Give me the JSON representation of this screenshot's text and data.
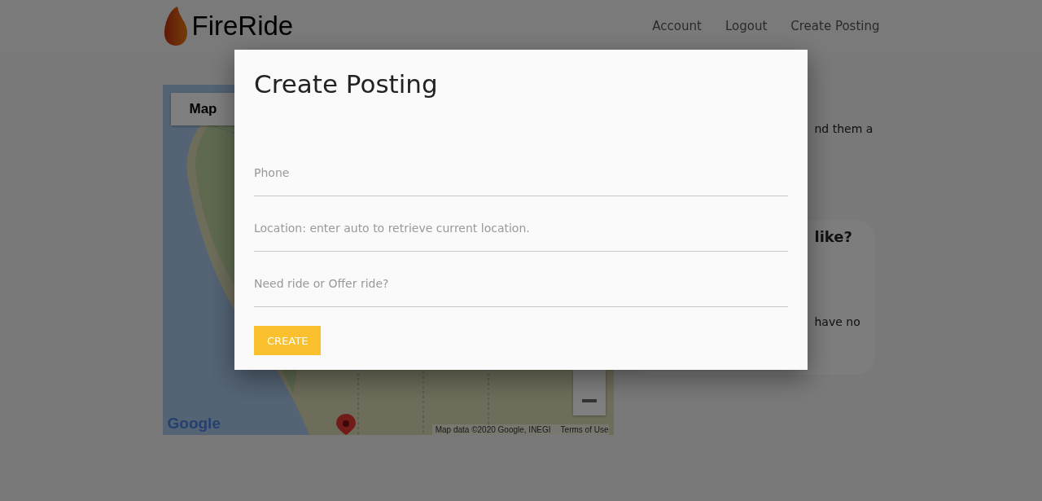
{
  "header": {
    "brand": "FireRide",
    "nav": [
      {
        "label": "Account"
      },
      {
        "label": "Logout"
      },
      {
        "label": "Create Posting"
      }
    ]
  },
  "map": {
    "type_button": "Map",
    "logo": "Google",
    "attribution": "Map data ©2020 Google, INEGI",
    "terms": "Terms of Use"
  },
  "intro": {
    "text_visible": "nd them a"
  },
  "card": {
    "heading_visible": "like?",
    "text_visible": "have no"
  },
  "dialog": {
    "title": "Create Posting",
    "fields": [
      {
        "placeholder": "Phone"
      },
      {
        "placeholder": "Location: enter auto to retrieve current location."
      },
      {
        "placeholder": "Need ride or Offer ride?"
      }
    ],
    "submit": "CREATE"
  }
}
